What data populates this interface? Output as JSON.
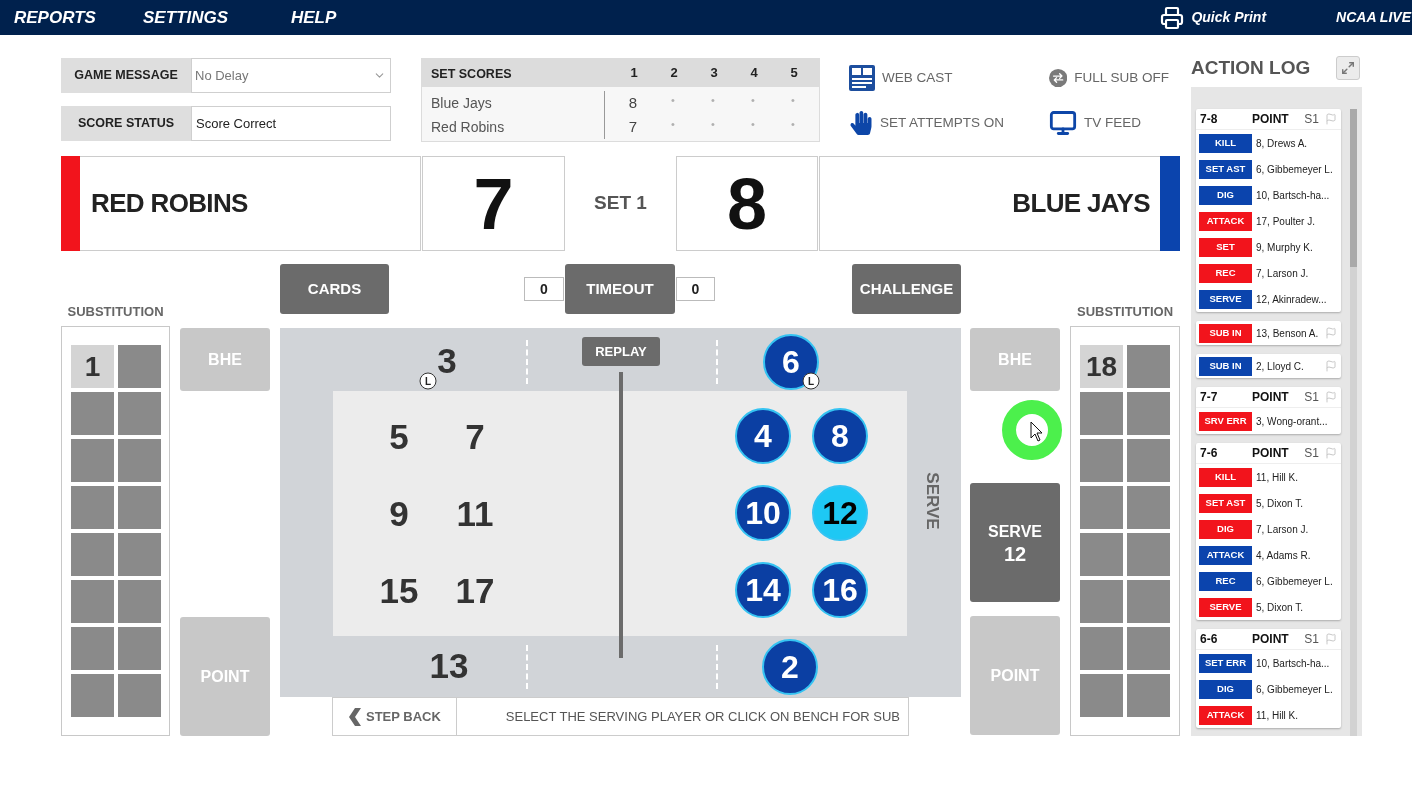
{
  "menu": [
    {
      "label": "REPORTS"
    },
    {
      "label": "SETTINGS"
    },
    {
      "label": "HELP"
    }
  ],
  "quick_print": "Quick Print",
  "brand": "NCAA LIVE",
  "game_message": {
    "label": "GAME MESSAGE",
    "value": "No Delay"
  },
  "score_status": {
    "label": "SCORE STATUS",
    "value": "Score Correct"
  },
  "set_scores": {
    "title": "SET SCORES",
    "columns": [
      "1",
      "2",
      "3",
      "4",
      "5"
    ],
    "rows": [
      {
        "team": "Blue Jays",
        "scores": [
          "8",
          "•",
          "•",
          "•",
          "•"
        ]
      },
      {
        "team": "Red Robins",
        "scores": [
          "7",
          "•",
          "•",
          "•",
          "•"
        ]
      }
    ]
  },
  "toggles": [
    {
      "kind": "webcast",
      "label": "WEB CAST"
    },
    {
      "kind": "full_sub",
      "label": "FULL SUB OFF"
    },
    {
      "kind": "set_attempts",
      "label": "SET ATTEMPTS ON"
    },
    {
      "kind": "tv_feed",
      "label": "TV FEED"
    }
  ],
  "scoreboard": {
    "teams": [
      {
        "name": "RED ROBINS",
        "score": "7",
        "color": "#f2141c"
      },
      {
        "name": "BLUE JAYS",
        "score": "8",
        "color": "#0b44ad"
      }
    ],
    "set_label": "SET 1"
  },
  "controls": {
    "cards": "CARDS",
    "timeout": "TIMEOUT",
    "timeouts": [
      "0",
      "0"
    ],
    "challenge": "CHALLENGE"
  },
  "benches": [
    {
      "label": "SUBSTITUTION",
      "players": [
        "1"
      ]
    },
    {
      "label": "SUBSTITUTION",
      "players": [
        "18"
      ]
    }
  ],
  "left_buttons": [
    {
      "kind": "bhe",
      "label": "BHE",
      "disabled": true
    },
    {
      "kind": "point",
      "label": "POINT",
      "disabled": true
    }
  ],
  "right_buttons": [
    {
      "kind": "bhe",
      "label": "BHE",
      "disabled": true
    },
    {
      "kind": "serve",
      "label": "SERVE",
      "number": "12",
      "disabled": false
    },
    {
      "kind": "point",
      "label": "POINT",
      "disabled": true
    }
  ],
  "court": {
    "replay": "REPLAY",
    "serve_label": "SERVE",
    "teams": [
      {
        "kind": "plain",
        "players": [
          {
            "number": "3",
            "badge": "L",
            "selected": false
          },
          {
            "number": "5",
            "selected": false
          },
          {
            "number": "7",
            "selected": false
          },
          {
            "number": "9",
            "selected": false
          },
          {
            "number": "11",
            "selected": false
          },
          {
            "number": "15",
            "selected": false
          },
          {
            "number": "17",
            "selected": false
          },
          {
            "number": "13",
            "selected": false
          }
        ]
      },
      {
        "kind": "disc",
        "players": [
          {
            "number": "6",
            "badge": "L",
            "selected": false
          },
          {
            "number": "4",
            "selected": false
          },
          {
            "number": "8",
            "selected": false
          },
          {
            "number": "10",
            "selected": false
          },
          {
            "number": "12",
            "selected": true
          },
          {
            "number": "14",
            "selected": false
          },
          {
            "number": "16",
            "selected": false
          },
          {
            "number": "2",
            "selected": false
          }
        ]
      }
    ]
  },
  "step_back": "STEP BACK",
  "instruction": "SELECT THE SERVING PLAYER OR CLICK ON BENCH FOR SUB",
  "action_log": {
    "title": "ACTION LOG",
    "entries": [
      {
        "kind": "point",
        "score": "7-8",
        "label": "POINT",
        "set": "S1",
        "actions": [
          {
            "label": "KILL",
            "player": "8, Drews A.",
            "color": "#0b44ad"
          },
          {
            "label": "SET AST",
            "player": "6, Gibbemeyer L.",
            "color": "#0b44ad"
          },
          {
            "label": "DIG",
            "player": "10, Bartsch-ha...",
            "color": "#0b44ad"
          },
          {
            "label": "ATTACK",
            "player": "17, Poulter J.",
            "color": "#f2141c"
          },
          {
            "label": "SET",
            "player": "9, Murphy K.",
            "color": "#f2141c"
          },
          {
            "label": "REC",
            "player": "7, Larson J.",
            "color": "#f2141c"
          },
          {
            "label": "SERVE",
            "player": "12, Akinradew...",
            "color": "#0b44ad"
          }
        ]
      },
      {
        "kind": "sub",
        "actions": [
          {
            "label": "SUB IN",
            "player": "13, Benson A.",
            "color": "#f2141c"
          }
        ]
      },
      {
        "kind": "sub",
        "actions": [
          {
            "label": "SUB IN",
            "player": "2, Lloyd C.",
            "color": "#0b44ad"
          }
        ]
      },
      {
        "kind": "point",
        "score": "7-7",
        "label": "POINT",
        "set": "S1",
        "actions": [
          {
            "label": "SRV ERR",
            "player": "3, Wong-orant...",
            "color": "#f2141c"
          }
        ]
      },
      {
        "kind": "point",
        "score": "7-6",
        "label": "POINT",
        "set": "S1",
        "actions": [
          {
            "label": "KILL",
            "player": "11, Hill K.",
            "color": "#f2141c"
          },
          {
            "label": "SET AST",
            "player": "5, Dixon T.",
            "color": "#f2141c"
          },
          {
            "label": "DIG",
            "player": "7, Larson J.",
            "color": "#f2141c"
          },
          {
            "label": "ATTACK",
            "player": "4, Adams R.",
            "color": "#0b44ad"
          },
          {
            "label": "REC",
            "player": "6, Gibbemeyer L.",
            "color": "#0b44ad"
          },
          {
            "label": "SERVE",
            "player": "5, Dixon T.",
            "color": "#f2141c"
          }
        ]
      },
      {
        "kind": "point",
        "score": "6-6",
        "label": "POINT",
        "set": "S1",
        "actions": [
          {
            "label": "SET ERR",
            "player": "10, Bartsch-ha...",
            "color": "#0b44ad"
          },
          {
            "label": "DIG",
            "player": "6, Gibbemeyer L.",
            "color": "#0b44ad"
          },
          {
            "label": "ATTACK",
            "player": "11, Hill K.",
            "color": "#f2141c"
          }
        ]
      }
    ]
  }
}
